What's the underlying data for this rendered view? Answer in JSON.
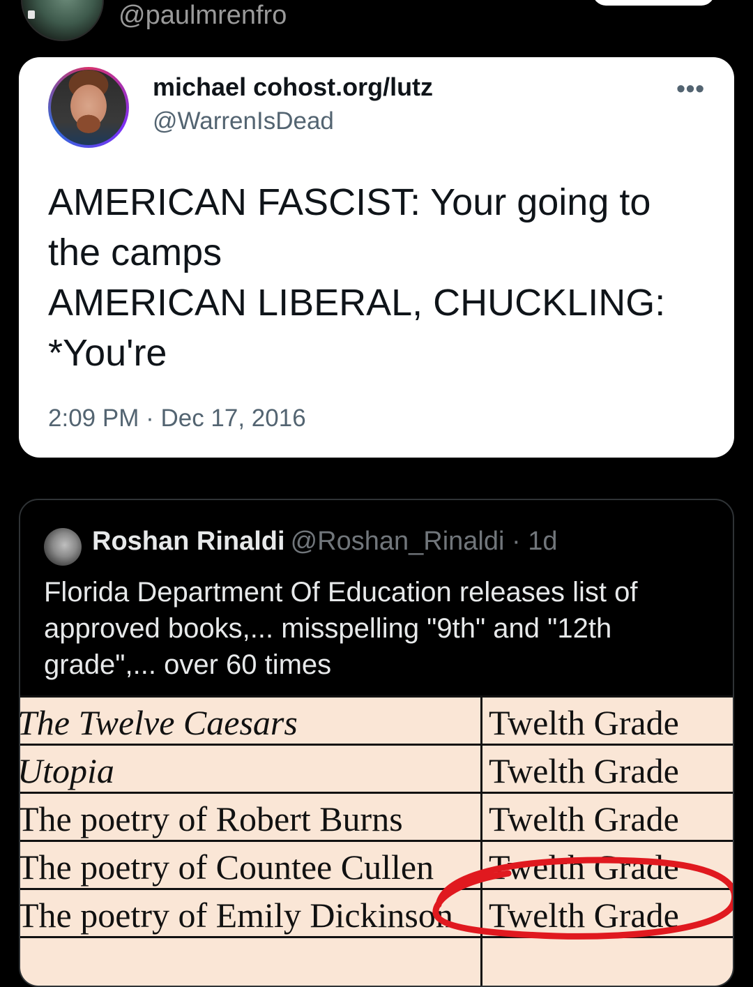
{
  "top": {
    "handle": "@paulmrenfro"
  },
  "tweet": {
    "name": "michael cohost.org/lutz",
    "handle": "@WarrenIsDead",
    "more": "•••",
    "lines": [
      "AMERICAN FASCIST: Your going to",
      "the camps",
      "AMERICAN LIBERAL, CHUCKLING:",
      "*You're"
    ],
    "timestamp": "2:09 PM · Dec 17, 2016"
  },
  "quote": {
    "name": "Roshan Rinaldi",
    "meta": "@Roshan_Rinaldi · 1d",
    "lines": [
      "Florida Department Of Education releases list of",
      "approved books,... misspelling \"9th\" and \"12th",
      "grade\",... over 60 times"
    ]
  },
  "table": {
    "rows": [
      {
        "book": "The Twelve Caesars",
        "grade": "Twelth Grade"
      },
      {
        "book": "Utopia",
        "grade": "Twelth Grade"
      },
      {
        "book": "The poetry of Robert Burns",
        "grade": "Twelth Grade"
      },
      {
        "book": "The poetry of Countee Cullen",
        "grade": "Twelth Grade"
      },
      {
        "book": "The poetry of Emily Dickinson",
        "grade": "Twelth Grade"
      }
    ]
  },
  "colors": {
    "annotation_circle": "#e0191f",
    "table_bg": "#fae6d6",
    "avatar_ring": "#d6336c"
  }
}
